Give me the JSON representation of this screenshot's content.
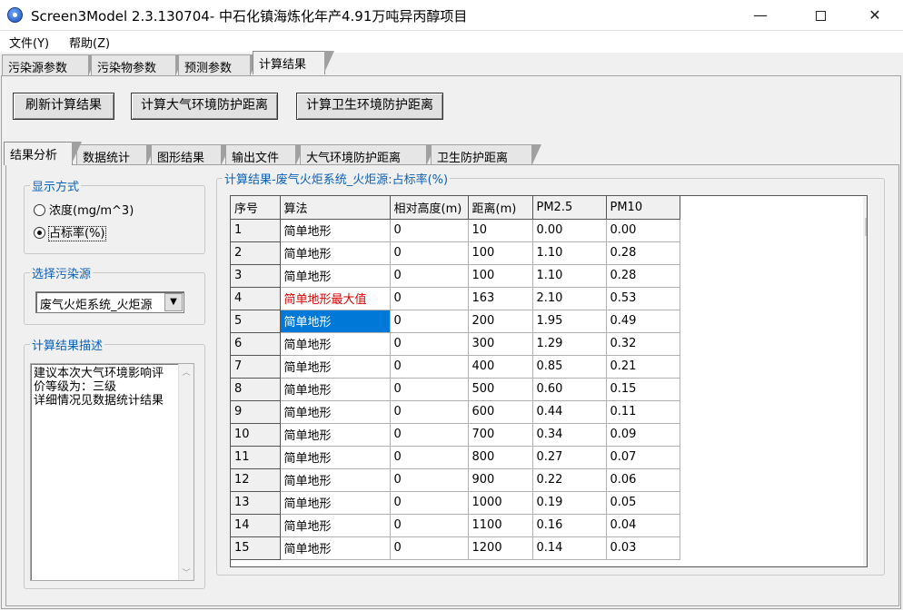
{
  "window": {
    "title": "Screen3Model 2.3.130704- 中石化镇海炼化年产4.91万吨异丙醇项目",
    "minimize_glyph": "—",
    "close_glyph": "✕"
  },
  "menu": [
    "文件(Y)",
    "帮助(Z)"
  ],
  "outer_tabs": [
    "污染源参数",
    "污染物参数",
    "预测参数",
    "计算结果"
  ],
  "toolbar": {
    "refresh_label": "刷新计算结果",
    "atm_distance_label": "计算大气环境防护距离",
    "health_distance_label": "计算卫生环境防护距离"
  },
  "inner_tabs": [
    "结果分析",
    "数据统计",
    "图形结果",
    "输出文件",
    "大气环境防护距离",
    "卫生防护距离"
  ],
  "display_mode": {
    "title": "显示方式",
    "options": [
      "浓度(mg/m^3)",
      "占标率(%)"
    ],
    "selected": "占标率(%)"
  },
  "source_select": {
    "title": "选择污染源",
    "value": "废气火炬系统_火炬源"
  },
  "description": {
    "title": "计算结果描述",
    "text": "建议本次大气环境影响评价等级为：三级\n详细情况见数据统计结果"
  },
  "results": {
    "title": "计算结果-废气火炬系统_火炬源:占标率(%)",
    "columns": [
      "序号",
      "算法",
      "相对高度(m)",
      "距离(m)",
      "PM2.5",
      "PM10"
    ],
    "rows": [
      [
        "1",
        "简单地形",
        "0",
        "10",
        "0.00",
        "0.00"
      ],
      [
        "2",
        "简单地形",
        "0",
        "100",
        "1.10",
        "0.28"
      ],
      [
        "3",
        "简单地形",
        "0",
        "100",
        "1.10",
        "0.28"
      ],
      [
        "4",
        "简单地形最大值",
        "0",
        "163",
        "2.10",
        "0.53"
      ],
      [
        "5",
        "简单地形",
        "0",
        "200",
        "1.95",
        "0.49"
      ],
      [
        "6",
        "简单地形",
        "0",
        "300",
        "1.29",
        "0.32"
      ],
      [
        "7",
        "简单地形",
        "0",
        "400",
        "0.85",
        "0.21"
      ],
      [
        "8",
        "简单地形",
        "0",
        "500",
        "0.60",
        "0.15"
      ],
      [
        "9",
        "简单地形",
        "0",
        "600",
        "0.44",
        "0.11"
      ],
      [
        "10",
        "简单地形",
        "0",
        "700",
        "0.34",
        "0.09"
      ],
      [
        "11",
        "简单地形",
        "0",
        "800",
        "0.27",
        "0.07"
      ],
      [
        "12",
        "简单地形",
        "0",
        "900",
        "0.22",
        "0.06"
      ],
      [
        "13",
        "简单地形",
        "0",
        "1000",
        "0.19",
        "0.05"
      ],
      [
        "14",
        "简单地形",
        "0",
        "1100",
        "0.16",
        "0.04"
      ],
      [
        "15",
        "简单地形",
        "0",
        "1200",
        "0.14",
        "0.03"
      ]
    ],
    "highlight_row": 4,
    "selected_row": 5,
    "highlight_color": "#e00000",
    "selection_color": "#0078d7"
  }
}
